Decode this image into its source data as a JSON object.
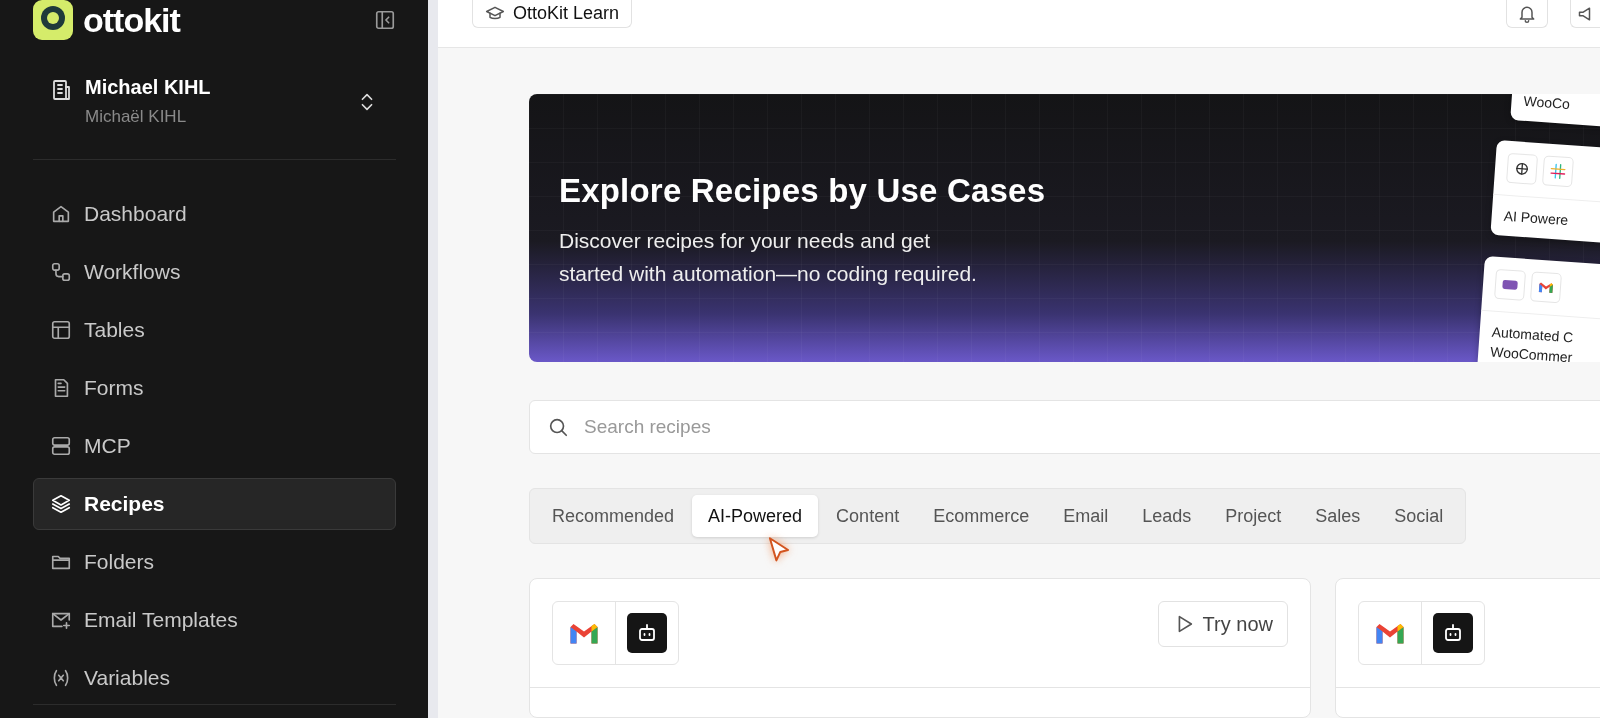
{
  "sidebar": {
    "logo": "ottokit",
    "workspace": {
      "name": "Michael KIHL",
      "subname": "Michaël KIHL"
    },
    "items": [
      {
        "label": "Dashboard",
        "selected": false
      },
      {
        "label": "Workflows",
        "selected": false
      },
      {
        "label": "Tables",
        "selected": false
      },
      {
        "label": "Forms",
        "selected": false
      },
      {
        "label": "MCP",
        "selected": false
      },
      {
        "label": "Recipes",
        "selected": true
      },
      {
        "label": "Folders",
        "selected": false
      },
      {
        "label": "Email Templates",
        "selected": false
      },
      {
        "label": "Variables",
        "selected": false
      }
    ]
  },
  "topbar": {
    "learn_button": "OttoKit Learn"
  },
  "hero": {
    "title": "Explore Recipes by Use Cases",
    "description": "Discover recipes for your needs and get started with automation—no coding required.",
    "preview_cards": [
      {
        "lines": [
          "WooCo"
        ]
      },
      {
        "lines": [
          "AI Powere"
        ]
      },
      {
        "lines": [
          "Automated C",
          "WooCommer"
        ]
      }
    ]
  },
  "search": {
    "placeholder": "Search recipes"
  },
  "tabs": [
    {
      "label": "Recommended",
      "selected": false
    },
    {
      "label": "AI-Powered",
      "selected": true
    },
    {
      "label": "Content",
      "selected": false
    },
    {
      "label": "Ecommerce",
      "selected": false
    },
    {
      "label": "Email",
      "selected": false
    },
    {
      "label": "Leads",
      "selected": false
    },
    {
      "label": "Project",
      "selected": false
    },
    {
      "label": "Sales",
      "selected": false
    },
    {
      "label": "Social",
      "selected": false
    }
  ],
  "cards": [
    {
      "kind": "with_action",
      "action": "Try now"
    },
    {
      "kind": "plain"
    }
  ]
}
